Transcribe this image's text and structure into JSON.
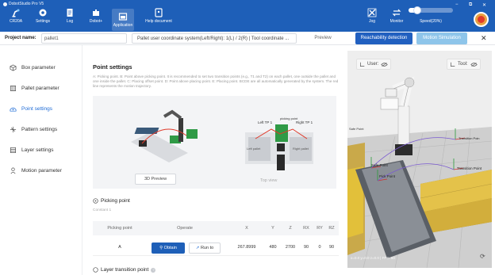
{
  "window": {
    "title": "DobotStudio Pro V5",
    "toolbar": [
      {
        "label": "CR20A",
        "icon": "robot-arm-icon"
      },
      {
        "label": "Settings",
        "icon": "gear-icon"
      },
      {
        "label": "Log",
        "icon": "document-icon"
      },
      {
        "label": "Dobot+",
        "icon": "puzzle-icon"
      },
      {
        "label": "Application",
        "icon": "apps-icon"
      },
      {
        "label": "Help document",
        "icon": "help-doc-icon"
      }
    ],
    "right_tools": [
      {
        "label": "Jog",
        "icon": "jog-icon"
      },
      {
        "label": "Monitor",
        "icon": "monitor-icon"
      }
    ],
    "speed_label": "Speed(20%)",
    "speed_value": 0.2,
    "controls": {
      "minimize": "−",
      "restore": "⧉",
      "close": "✕"
    }
  },
  "project": {
    "label": "Project name:",
    "name": "pallet1",
    "description": "Pallet user coordinate system(Left/Right): 1(L) / 2(R) | Tool coordinate ...",
    "preview_label": "Preview",
    "reachability_label": "Reachability detection",
    "motion_sim_label": "Motion Simulation",
    "close_symbol": "✕"
  },
  "sidebar": {
    "items": [
      {
        "label": "Box parameter",
        "icon": "box-icon",
        "active": false
      },
      {
        "label": "Pallet parameter",
        "icon": "pallet-icon",
        "active": false
      },
      {
        "label": "Point settings",
        "icon": "point-settings-icon",
        "active": true
      },
      {
        "label": "Pattern settings",
        "icon": "pattern-icon",
        "active": false
      },
      {
        "label": "Layer settings",
        "icon": "layers-icon",
        "active": false
      },
      {
        "label": "Motion parameter",
        "icon": "motion-icon",
        "active": false
      }
    ]
  },
  "point_settings": {
    "title": "Point settings",
    "description": "A: Picking point. B: Point above picking point. It is recommended to set two transition points (e.g., T1 and T2) on each pallet, one outside the pallet and one inside the pallet. C: Placing offset point. D: Point above placing point. E: Placing point. BCDE are all automatically generated by the system. The red line represents the motion trajectory.",
    "illustration": {
      "left_tp": "Left TP 1",
      "right_tp": "Right TP 1",
      "picking_point": "picking point",
      "left_pallet": "Left pallet",
      "right_pallet": "Right pallet"
    },
    "preview_3d_label": "3D Preview",
    "top_view_label": "Top view",
    "picking_title": "Picking point",
    "picking_subtitle": "Constant 1",
    "table": {
      "headers": [
        "Picking point",
        "Operate",
        "X",
        "Y",
        "Z",
        "RX",
        "RY",
        "RZ"
      ],
      "rows": [
        {
          "name": "A",
          "obtain": "Obtain",
          "run_to": "Run to",
          "x": "267.8999",
          "y": "480",
          "z": "2700",
          "rx": "90",
          "ry": "0",
          "rz": "90"
        }
      ]
    },
    "layer_title": "Layer transition point",
    "help_symbol": "?"
  },
  "viewport": {
    "user_label": "User:",
    "tool_label": "Tool:",
    "labels": {
      "safe_point": "Safe Point",
      "pick_point": "Pick Point",
      "transition_point": "Transition Point",
      "transition_point_2": "Transition Poin"
    },
    "readout": "x=0.0 y=0.0 z=0.0 | FPS: 60",
    "refresh_symbol": "⟳"
  },
  "colors": {
    "titlebar": "#1e5fb8",
    "accent": "#1e6bd6",
    "disabled_button": "#8ec5ea",
    "estop": "#e03a2a"
  }
}
